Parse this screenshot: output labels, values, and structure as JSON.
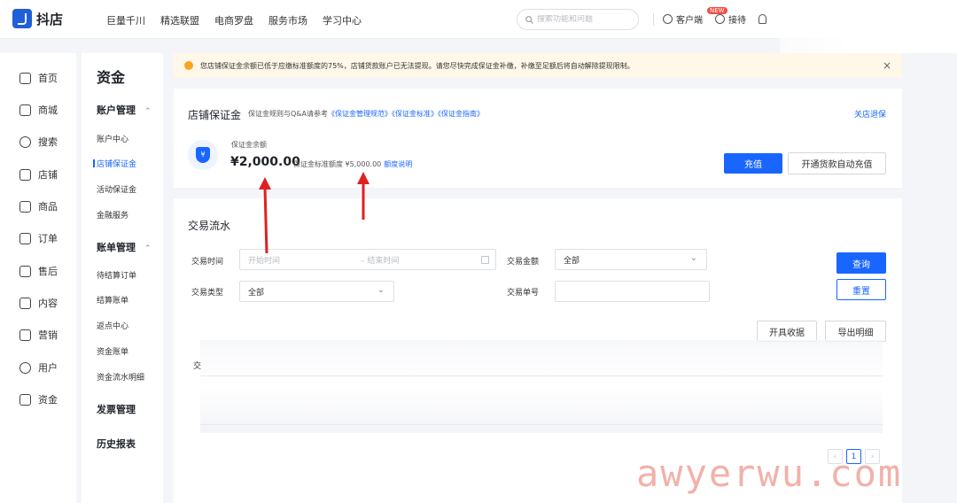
{
  "header": {
    "logo_text": "抖店",
    "nav": [
      "巨量千川",
      "精选联盟",
      "电商罗盘",
      "服务市场",
      "学习中心"
    ],
    "search_placeholder": "搜索功能和问题",
    "customer_service": "客户端",
    "new_badge": "NEW",
    "share": "接待"
  },
  "leftnav": [
    "首页",
    "商城",
    "搜索",
    "店铺",
    "商品",
    "订单",
    "售后",
    "内容",
    "营销",
    "用户",
    "资金"
  ],
  "subnav": {
    "title": "资金",
    "group_account": "账户管理",
    "items_account": [
      "账户中心",
      "店铺保证金",
      "活动保证金",
      "金融服务"
    ],
    "group_bill": "账单管理",
    "items_bill": [
      "待结算订单",
      "结算账单",
      "返点中心",
      "资金账单",
      "资金流水明细"
    ],
    "group_invoice": "发票管理",
    "group_history": "历史报表"
  },
  "alert": {
    "text": "您店铺保证金余额已低于应缴标准额度的75%，店铺货款账户已无法提现。请您尽快完成保证金补缴，补缴至足额后将自动解除提现限制。"
  },
  "deposit": {
    "title": "店铺保证金",
    "refs_prefix": "保证金规则与Q&A请参考",
    "ref1": "《保证金管理规范》",
    "ref2": "《保证金标准》",
    "ref3": "《保证金指南》",
    "close_link": "关店退保",
    "shield_symbol": "¥",
    "balance_label": "保证金余额",
    "balance_value": "¥2,000.00",
    "std_label": "保证金标准额度 ¥5,000.00",
    "std_link": "额度说明",
    "recharge_button": "充值",
    "auto_button": "开通货款自动充值"
  },
  "flow": {
    "title": "交易流水",
    "time_label": "交易时间",
    "start_placeholder": "开始时间",
    "end_placeholder": "结束时间",
    "amount_label": "交易金额",
    "amount_value": "全部",
    "type_label": "交易类型",
    "type_value": "全部",
    "order_label": "交易单号",
    "query_button": "查询",
    "reset_button": "重置",
    "receipt_button": "开具收据",
    "export_button": "导出明细",
    "table_col_partial": "交",
    "page_current": "1"
  },
  "watermark": "awyerwu.com",
  "colors": {
    "primary": "#1966ff",
    "alert_bg": "#fff7e8",
    "arrow_red": "#e02020"
  }
}
